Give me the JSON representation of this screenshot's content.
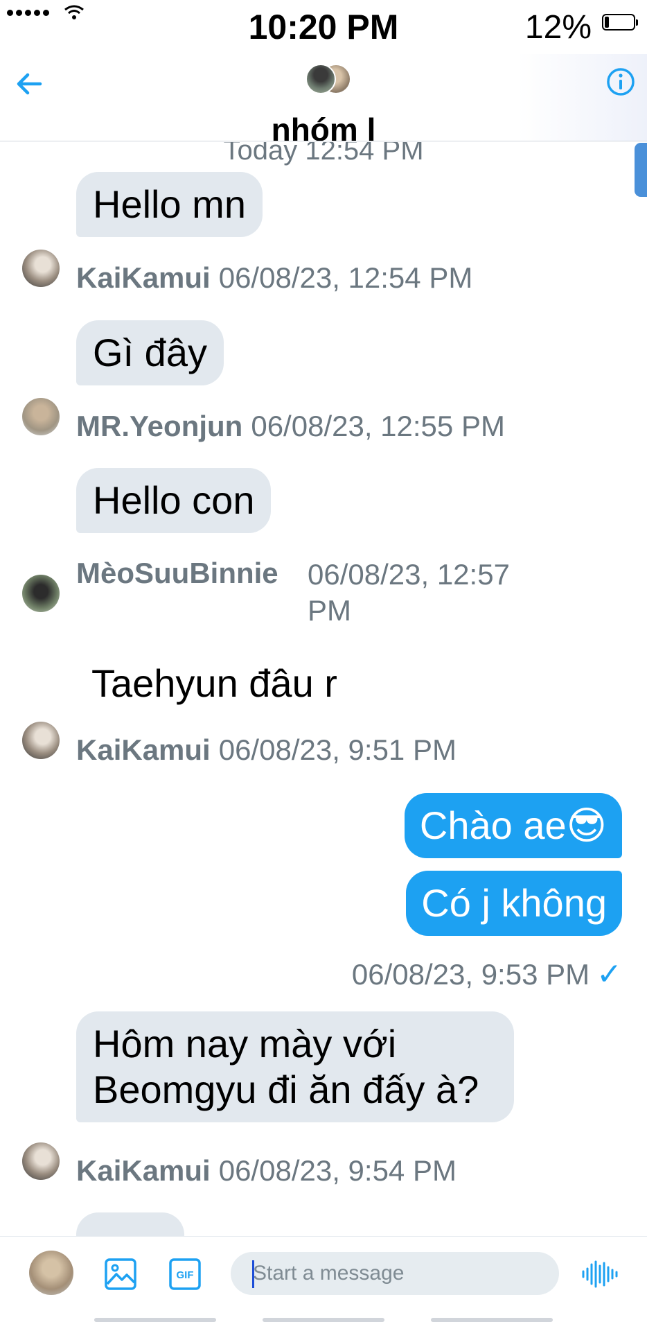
{
  "status_bar": {
    "time": "10:20 PM",
    "battery_percent": "12%"
  },
  "header": {
    "group_name": "nhóm l",
    "back_icon": "arrow-left-icon",
    "info_icon": "info-icon"
  },
  "chat": {
    "day_label": "Today 12:54 PM",
    "messages": [
      {
        "sender": "KaiKamui",
        "text": "Hello mn",
        "time": "06/08/23, 12:54 PM"
      },
      {
        "sender": "MR.Yeonjun",
        "text": "Gì đây",
        "time": "06/08/23, 12:55 PM"
      },
      {
        "sender": "MèoSuuBinnie",
        "text": "Hello con",
        "time_line1": "06/08/23, 12:57",
        "time_line2": "PM"
      },
      {
        "sender": "KaiKamui",
        "text": "Taehyun đâu r",
        "time": "06/08/23, 9:51 PM"
      },
      {
        "sender": "KaiKamui",
        "text_line1": "Hôm nay mày với",
        "text_line2": "Beomgyu đi ăn đấy à?",
        "time": "06/08/23, 9:54 PM"
      }
    ],
    "outgoing": {
      "message1": "Chào ae😎",
      "message2": "Có j không",
      "time": "06/08/23, 9:53 PM",
      "status": "✓"
    }
  },
  "compose": {
    "placeholder": "Start a message",
    "gif_label": "GIF"
  },
  "colors": {
    "accent": "#1da1f2",
    "incoming_bubble": "#e2e8ee",
    "meta_text": "#6b7780"
  }
}
